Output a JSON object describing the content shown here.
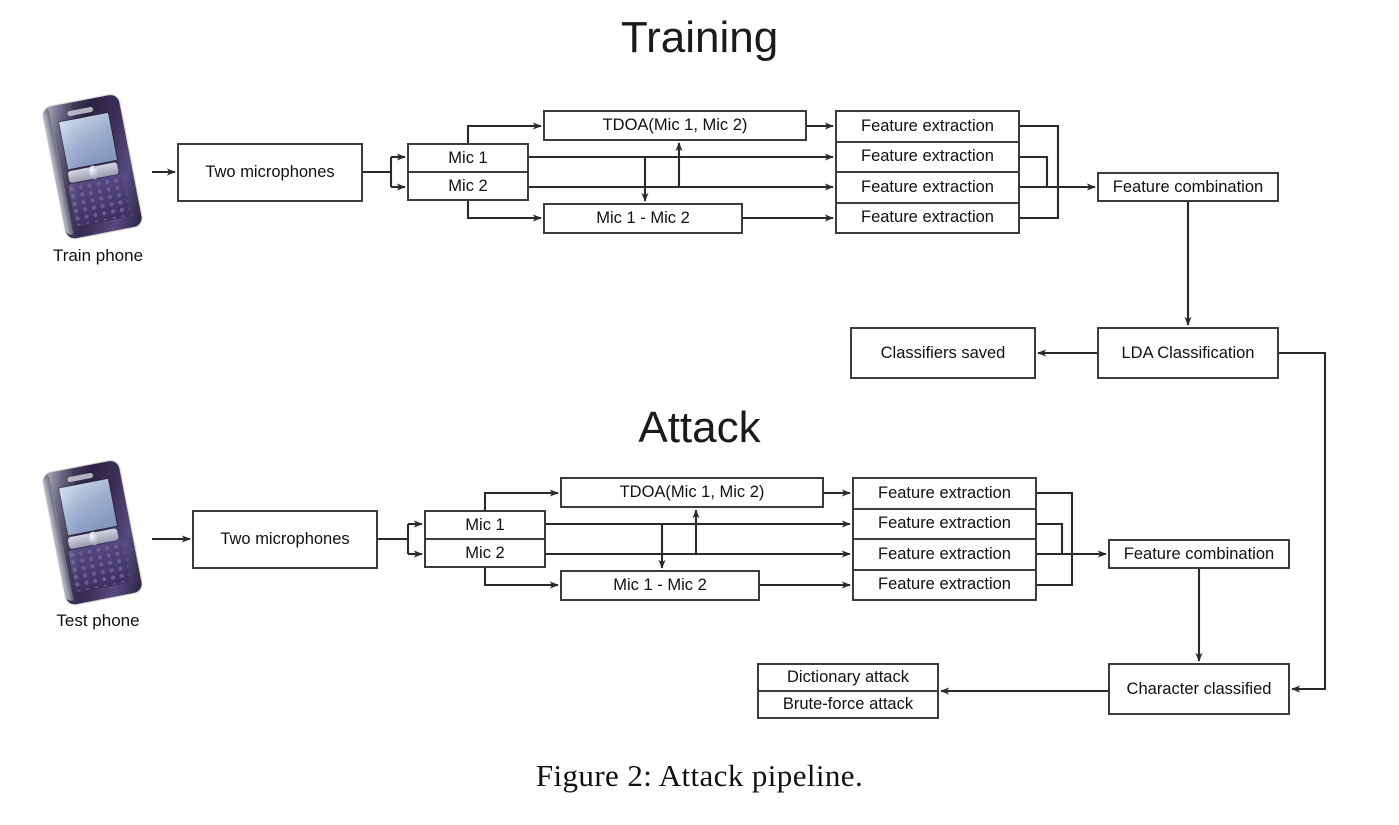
{
  "figure": {
    "caption": "Figure 2:  Attack pipeline."
  },
  "sections": [
    {
      "id": "training",
      "title": "Training",
      "phone": {
        "icon": "smartphone-icon",
        "label": "Train phone"
      },
      "source_box": "Two microphones",
      "mic_rows": [
        "Mic 1",
        "Mic 2"
      ],
      "tdoa_box": "TDOA(Mic 1, Mic 2)",
      "diff_box": "Mic 1 - Mic 2",
      "feature_rows": [
        "Feature extraction",
        "Feature extraction",
        "Feature extraction",
        "Feature extraction"
      ],
      "combination_box": "Feature combination",
      "classify_box": "LDA Classification",
      "output_box": "Classifiers saved"
    },
    {
      "id": "attack",
      "title": "Attack",
      "phone": {
        "icon": "smartphone-icon",
        "label": "Test phone"
      },
      "source_box": "Two microphones",
      "mic_rows": [
        "Mic 1",
        "Mic 2"
      ],
      "tdoa_box": "TDOA(Mic 1, Mic 2)",
      "diff_box": "Mic 1 - Mic 2",
      "feature_rows": [
        "Feature extraction",
        "Feature extraction",
        "Feature extraction",
        "Feature extraction"
      ],
      "combination_box": "Feature combination",
      "classify_box": "Character classified",
      "attack_rows": [
        "Dictionary attack",
        "Brute-force attack"
      ]
    }
  ],
  "colors": {
    "stroke": "#3c3c3c",
    "text": "#111111",
    "background": "#ffffff",
    "phone_body": "#2c2342",
    "phone_screen": "#9fb0cf"
  }
}
